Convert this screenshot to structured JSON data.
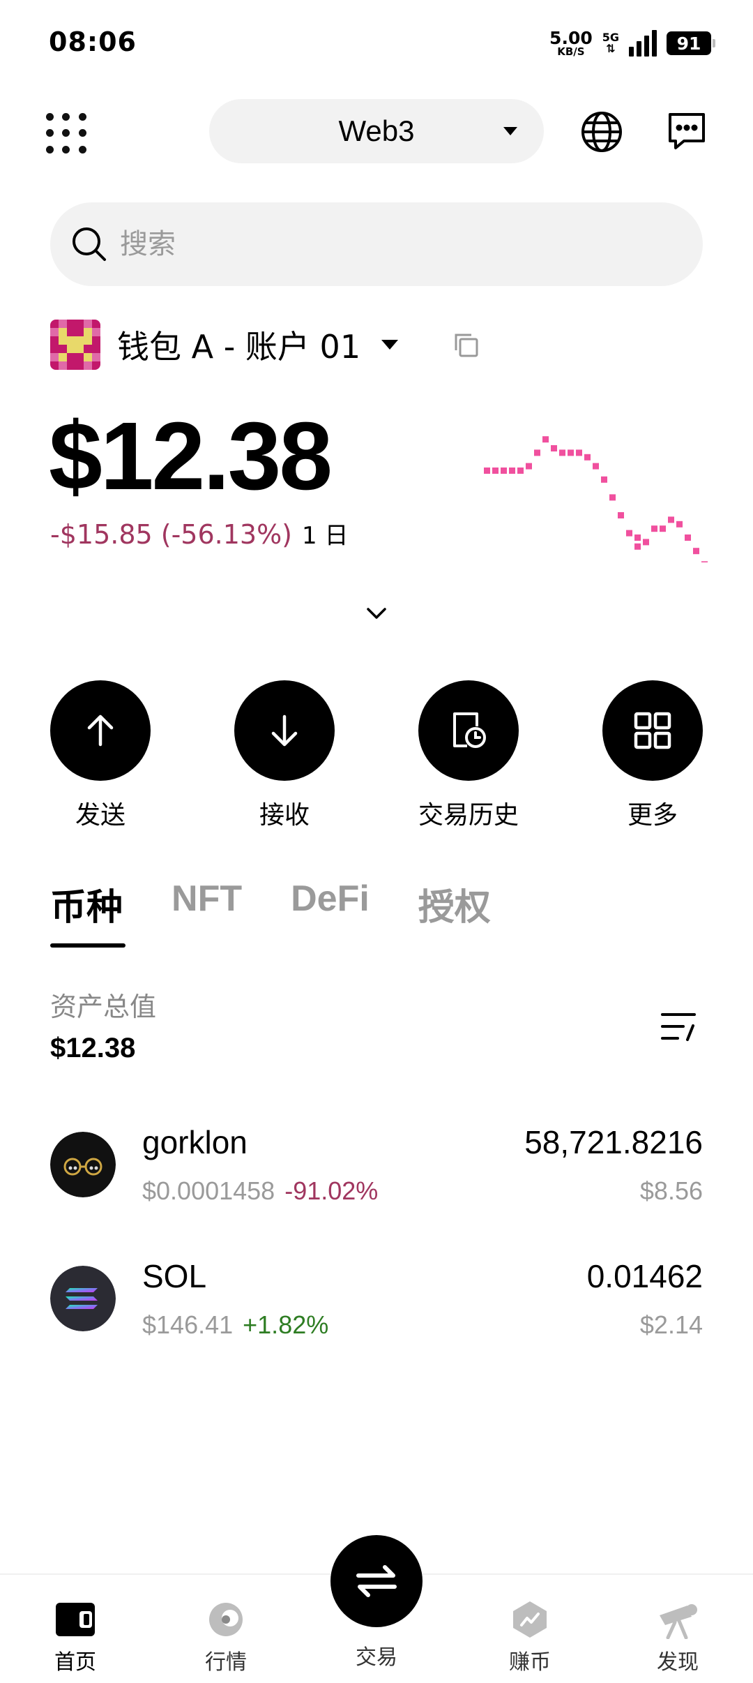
{
  "status_bar": {
    "time": "08:06",
    "net_speed_value": "5.00",
    "net_speed_unit": "KB/S",
    "network_type": "5G",
    "battery": "91"
  },
  "header": {
    "network_selector": "Web3"
  },
  "search": {
    "placeholder": "搜索"
  },
  "account": {
    "name": "钱包 A - 账户 01"
  },
  "balance": {
    "total": "$12.38",
    "change": "-$15.85 (-56.13%)",
    "period": "1 日"
  },
  "actions": [
    {
      "label": "发送",
      "icon": "arrow-up-icon"
    },
    {
      "label": "接收",
      "icon": "arrow-down-icon"
    },
    {
      "label": "交易历史",
      "icon": "history-icon"
    },
    {
      "label": "更多",
      "icon": "grid-icon"
    }
  ],
  "tabs": [
    {
      "label": "币种",
      "active": true
    },
    {
      "label": "NFT",
      "active": false
    },
    {
      "label": "DeFi",
      "active": false
    },
    {
      "label": "授权",
      "active": false
    }
  ],
  "assets": {
    "total_label": "资产总值",
    "total_value": "$12.38"
  },
  "tokens": [
    {
      "name": "gorklon",
      "price": "$0.0001458",
      "change": "-91.02%",
      "direction": "negative",
      "amount": "58,721.8216",
      "usd": "$8.56"
    },
    {
      "name": "SOL",
      "price": "$146.41",
      "change": "+1.82%",
      "direction": "positive",
      "amount": "0.01462",
      "usd": "$2.14"
    }
  ],
  "bottom_nav": [
    {
      "label": "首页",
      "icon": "wallet-icon",
      "active": true
    },
    {
      "label": "行情",
      "icon": "market-icon",
      "active": false
    },
    {
      "label": "交易",
      "icon": "swap-icon",
      "active": false
    },
    {
      "label": "赚币",
      "icon": "earn-icon",
      "active": false
    },
    {
      "label": "发现",
      "icon": "discover-icon",
      "active": false
    }
  ],
  "colors": {
    "negative": "#a0365f",
    "positive": "#2e7d23",
    "sparkline": "#f0509e"
  }
}
